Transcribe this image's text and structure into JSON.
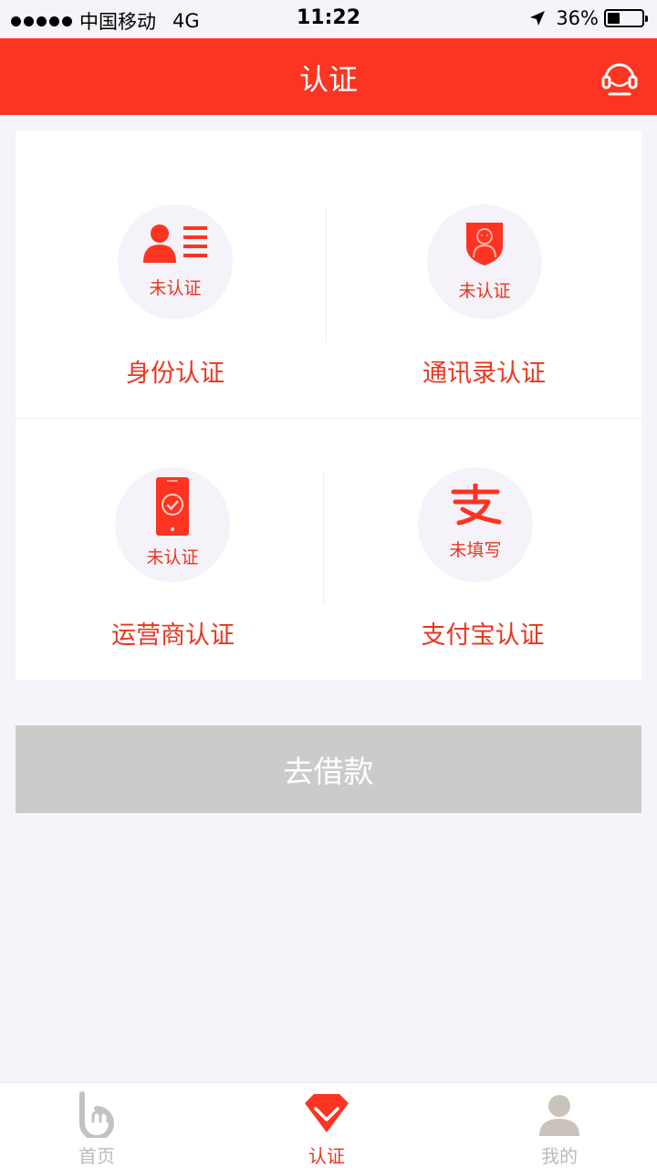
{
  "status_bar": {
    "carrier": "中国移动",
    "network": "4G",
    "time": "11:22",
    "battery": "36%",
    "battery_level": 0.36
  },
  "header": {
    "title": "认证",
    "service_icon": "headset-icon"
  },
  "auth_items": [
    {
      "label": "身份认证",
      "status": "未认证",
      "icon": "id-card-icon"
    },
    {
      "label": "通讯录认证",
      "status": "未认证",
      "icon": "shield-contact-icon"
    },
    {
      "label": "运营商认证",
      "status": "未认证",
      "icon": "phone-check-icon"
    },
    {
      "label": "支付宝认证",
      "status": "未填写",
      "icon": "alipay-icon"
    }
  ],
  "loan_button": {
    "label": "去借款"
  },
  "tab_bar": {
    "tabs": [
      {
        "label": "首页",
        "icon": "home-logo-icon",
        "active": false
      },
      {
        "label": "认证",
        "icon": "gem-check-icon",
        "active": true
      },
      {
        "label": "我的",
        "icon": "user-avatar-icon",
        "active": false
      }
    ]
  },
  "colors": {
    "accent": "#fc3421",
    "accent_text": "#e8361f",
    "button_disabled": "#cbcbcb",
    "page_bg": "#f6f3fa"
  }
}
